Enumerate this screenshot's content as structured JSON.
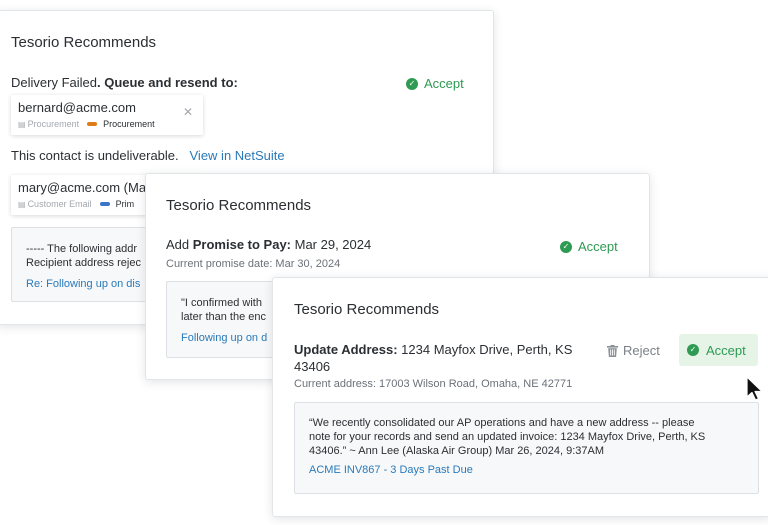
{
  "card1": {
    "title": "Tesorio Recommends",
    "delivery_failed": "Delivery Failed",
    "queue_resend": ". Queue and resend to:",
    "accept_label": "Accept",
    "contact1": {
      "email": "bernard@acme.com",
      "tag1": "Procurement",
      "tag2": "Procurement",
      "tag2_color": "#e07b1a"
    },
    "undeliverable": "This contact is undeliverable.",
    "view_link": "View in NetSuite",
    "contact2": {
      "email": "mary@acme.com (Ma",
      "tag1": "Customer Email",
      "tag2": "Prim",
      "tag2_color": "#3c74c7"
    },
    "quote_text": "----- The following addr\nRecipient address rejec",
    "quote_link": "Re: Following up on dis"
  },
  "card2": {
    "title": "Tesorio Recommends",
    "add_prefix": "Add ",
    "promise_label": "Promise to Pay:",
    "promise_date": " Mar 29, 2024",
    "accept_label": "Accept",
    "current_date": "Current promise date: Mar 30, 2024",
    "quote_text": "\"I confirmed with\nlater than the enc",
    "quote_link": "Following up on d"
  },
  "card3": {
    "title": "Tesorio Recommends",
    "update_label": "Update Address:",
    "new_address_line1": " 1234 Mayfox Drive, Perth, KS",
    "new_address_line2": "43406",
    "reject_label": "Reject",
    "accept_label": "Accept",
    "current_address": "Current address: 17003 Wilson Road, Omaha, NE 42771",
    "quote_text": "“We recently consolidated our AP operations and have a new address -- please\nnote for your records and send an updated invoice: 1234 Mayfox Drive, Perth, KS\n43406.” ~ Ann Lee (Alaska Air Group)  Mar 26, 2024, 9:37AM",
    "quote_link": "ACME INV867 - 3 Days Past Due"
  },
  "icons": {
    "check": "✓",
    "close": "✕",
    "tag": "▤"
  },
  "colors": {
    "accept_green": "#2f9a53",
    "accept_bg": "#e5f4e7",
    "link_blue": "#2a7ab9"
  }
}
